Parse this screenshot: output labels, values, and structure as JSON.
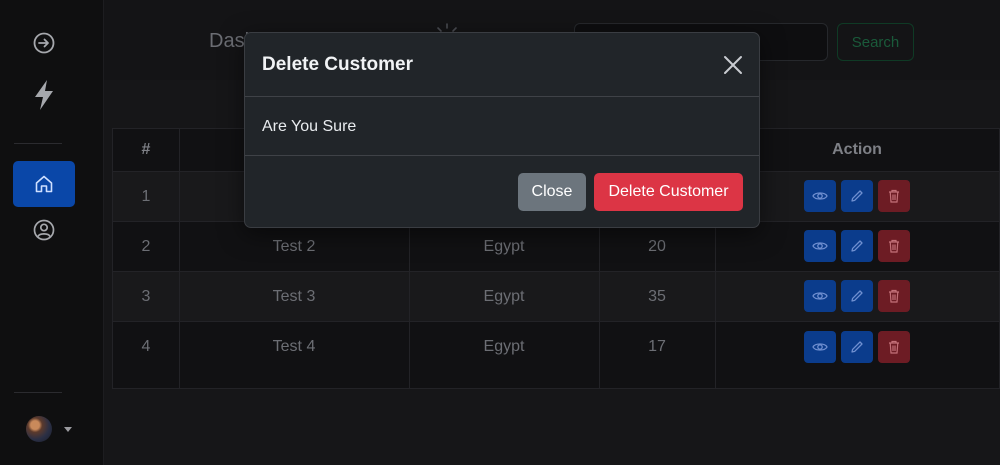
{
  "app": {
    "brand": "Dash"
  },
  "sidebar": {
    "items": [
      {
        "icon": "logout-arrow-icon"
      },
      {
        "icon": "lightning-icon"
      },
      {
        "icon": "home-icon",
        "active": true
      },
      {
        "icon": "user-circle-icon"
      }
    ],
    "avatar_icon": "avatar"
  },
  "search": {
    "placeholder": "",
    "button_label": "Search"
  },
  "table": {
    "headers": [
      "#",
      "",
      "",
      "",
      "Action"
    ],
    "rows": [
      {
        "id": "1",
        "name": "",
        "country": "",
        "age": ""
      },
      {
        "id": "2",
        "name": "Test 2",
        "country": "Egypt",
        "age": "20"
      },
      {
        "id": "3",
        "name": "Test 3",
        "country": "Egypt",
        "age": "35"
      },
      {
        "id": "4",
        "name": "Test 4",
        "country": "Egypt",
        "age": "17"
      }
    ],
    "action_icons": [
      "eye-icon",
      "pencil-icon",
      "trash-icon"
    ]
  },
  "modal": {
    "title": "Delete Customer",
    "body": "Are You Sure",
    "close_label": "Close",
    "delete_label": "Delete Customer"
  },
  "colors": {
    "primary": "#0d6efd",
    "danger": "#dc3545",
    "secondary": "#6c757d",
    "modal_bg": "#212529"
  }
}
